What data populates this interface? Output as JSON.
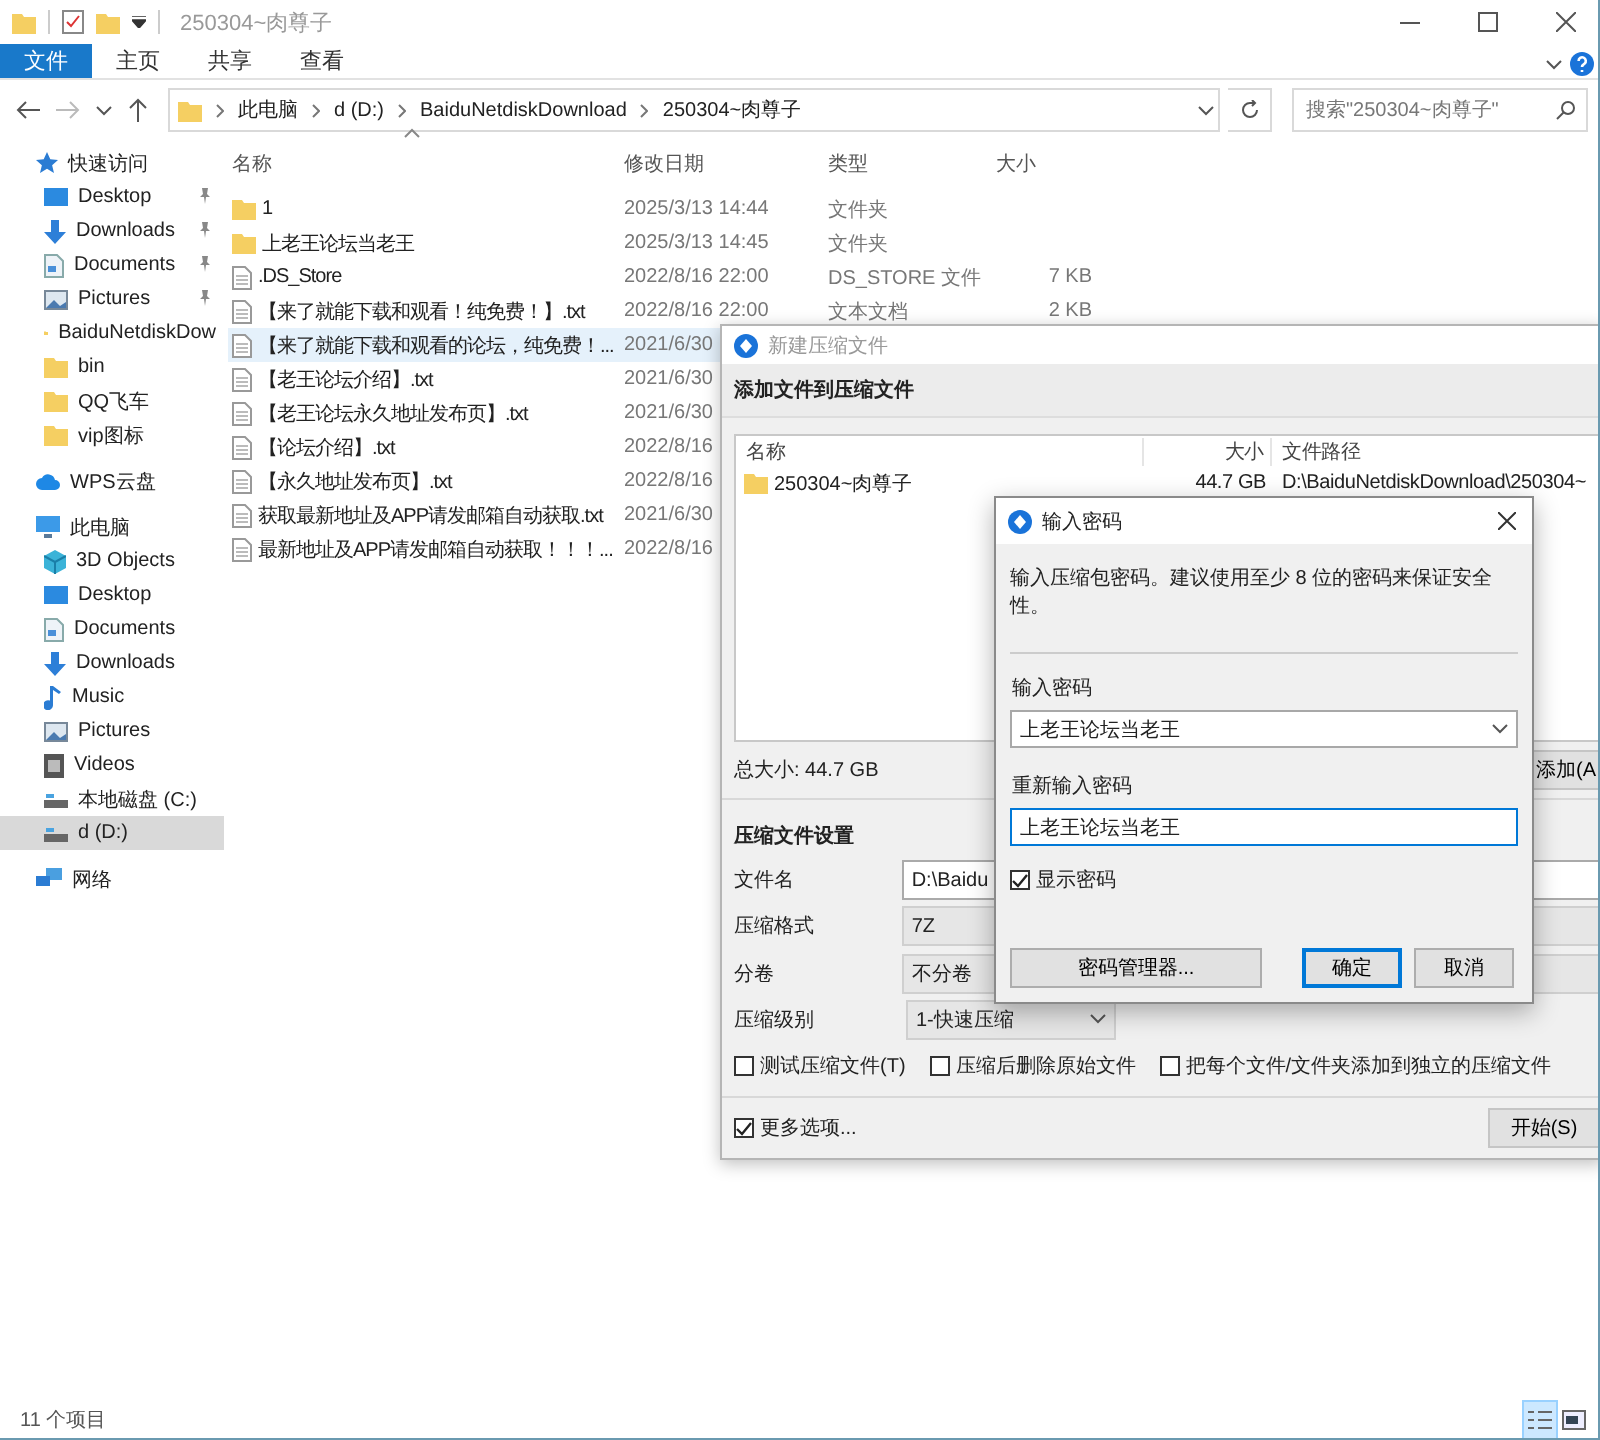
{
  "explorer": {
    "title": "250304~肉尊子",
    "ribbon_tabs": [
      {
        "label": "文件",
        "selected": true
      },
      {
        "label": "主页",
        "selected": false
      },
      {
        "label": "共享",
        "selected": false
      },
      {
        "label": "查看",
        "selected": false
      }
    ],
    "breadcrumb": [
      "此电脑",
      "d (D:)",
      "BaiduNetdiskDownload",
      "250304~肉尊子"
    ],
    "search": {
      "placeholder": "搜索\"250304~肉尊子\""
    },
    "sidebar": [
      {
        "label": "快速访问",
        "kind": "star",
        "selected": false,
        "children": [
          {
            "label": "Desktop",
            "kind": "desktop",
            "pinned": true,
            "selected": false
          },
          {
            "label": "Downloads",
            "kind": "download",
            "pinned": true,
            "selected": false
          },
          {
            "label": "Documents",
            "kind": "document",
            "pinned": true,
            "selected": false
          },
          {
            "label": "Pictures",
            "kind": "pictures",
            "pinned": true,
            "selected": false
          },
          {
            "label": "BaiduNetdiskDow",
            "kind": "folder",
            "pinned": false,
            "selected": false
          },
          {
            "label": "bin",
            "kind": "folder",
            "pinned": false,
            "selected": false
          },
          {
            "label": "QQ飞车",
            "kind": "folder",
            "pinned": false,
            "selected": false
          },
          {
            "label": "vip图标",
            "kind": "folder",
            "pinned": false,
            "selected": false
          }
        ]
      },
      {
        "label": "WPS云盘",
        "kind": "cloud",
        "selected": false
      },
      {
        "label": "此电脑",
        "kind": "pc",
        "selected": false,
        "children": [
          {
            "label": "3D Objects",
            "kind": "cube",
            "selected": false
          },
          {
            "label": "Desktop",
            "kind": "desktop",
            "selected": false
          },
          {
            "label": "Documents",
            "kind": "document",
            "selected": false
          },
          {
            "label": "Downloads",
            "kind": "download",
            "selected": false
          },
          {
            "label": "Music",
            "kind": "music",
            "selected": false
          },
          {
            "label": "Pictures",
            "kind": "pictures",
            "selected": false
          },
          {
            "label": "Videos",
            "kind": "video",
            "selected": false
          },
          {
            "label": "本地磁盘 (C:)",
            "kind": "drive",
            "selected": false
          },
          {
            "label": "d (D:)",
            "kind": "drive",
            "selected": true
          }
        ]
      },
      {
        "label": "网络",
        "kind": "network",
        "selected": false
      }
    ],
    "columns": [
      "名称",
      "修改日期",
      "类型",
      "大小"
    ],
    "files": [
      {
        "kind": "folder",
        "name": "1",
        "date": "2025/3/13 14:44",
        "type": "文件夹",
        "selected": false
      },
      {
        "kind": "folder",
        "name": "上老王论坛当老王",
        "date": "2025/3/13 14:45",
        "type": "文件夹",
        "selected": false
      },
      {
        "kind": "file",
        "name": ".DS_Store",
        "date": "2022/8/16 22:00",
        "type": "DS_STORE 文件",
        "size": "7 KB",
        "selected": false
      },
      {
        "kind": "file",
        "name": "【来了就能下载和观看！纯免费！】.txt",
        "date": "2022/8/16 22:00",
        "type": "文本文档",
        "size": "2 KB",
        "selected": false
      },
      {
        "kind": "file",
        "name": "【来了就能下载和观看的论坛，纯免费！...",
        "date": "2021/6/30",
        "selected": true
      },
      {
        "kind": "file",
        "name": "【老王论坛介绍】.txt",
        "date": "2021/6/30",
        "selected": false
      },
      {
        "kind": "file",
        "name": "【老王论坛永久地址发布页】.txt",
        "date": "2021/6/30",
        "selected": false
      },
      {
        "kind": "file",
        "name": "【论坛介绍】.txt",
        "date": "2022/8/16",
        "selected": false
      },
      {
        "kind": "file",
        "name": "【永久地址发布页】.txt",
        "date": "2022/8/16",
        "selected": false
      },
      {
        "kind": "file",
        "name": "获取最新地址及APP请发邮箱自动获取.txt",
        "date": "2021/6/30",
        "selected": false
      },
      {
        "kind": "file",
        "name": "最新地址及APP请发邮箱自动获取！！！...",
        "date": "2022/8/16",
        "selected": false
      }
    ],
    "status_bar": "11 个项目"
  },
  "compress_dialog": {
    "title": "新建压缩文件",
    "heading": "添加文件到压缩文件",
    "list_columns": [
      "名称",
      "大小",
      "文件路径"
    ],
    "list_rows": [
      {
        "name": "250304~肉尊子",
        "size": "44.7 GB",
        "path": "D:\\BaiduNetdiskDownload\\250304~"
      }
    ],
    "total": "总大小: 44.7 GB",
    "add_button": "添加(A",
    "settings_title": "压缩文件设置",
    "fields": [
      {
        "label": "文件名",
        "value": "D:\\Baidu",
        "kind": "text"
      },
      {
        "label": "压缩格式",
        "value": "7Z",
        "kind": "select"
      },
      {
        "label": "分卷",
        "value": "不分卷",
        "kind": "select"
      },
      {
        "label": "压缩级别",
        "value": "1-快速压缩",
        "kind": "dropdown"
      }
    ],
    "options": [
      {
        "label": "测试压缩文件(T)",
        "checked": false
      },
      {
        "label": "压缩后删除原始文件",
        "checked": false
      },
      {
        "label": "把每个文件/文件夹添加到独立的压缩文件",
        "checked": false
      }
    ],
    "more_options": {
      "label": "更多选项...",
      "checked": true
    },
    "start_button": "开始(S)"
  },
  "password_dialog": {
    "title": "输入密码",
    "description": "输入压缩包密码。建议使用至少 8 位的密码来保证安全性。",
    "password": {
      "label": "输入密码",
      "value": "上老王论坛当老王",
      "focused": false
    },
    "confirm": {
      "label": "重新输入密码",
      "value": "上老王论坛当老王",
      "focused": true
    },
    "show_password": {
      "label": "显示密码",
      "checked": true
    },
    "buttons": [
      {
        "label": "密码管理器...",
        "kind": "normal"
      },
      {
        "label": "确定",
        "kind": "default"
      },
      {
        "label": "取消",
        "kind": "normal"
      }
    ]
  }
}
